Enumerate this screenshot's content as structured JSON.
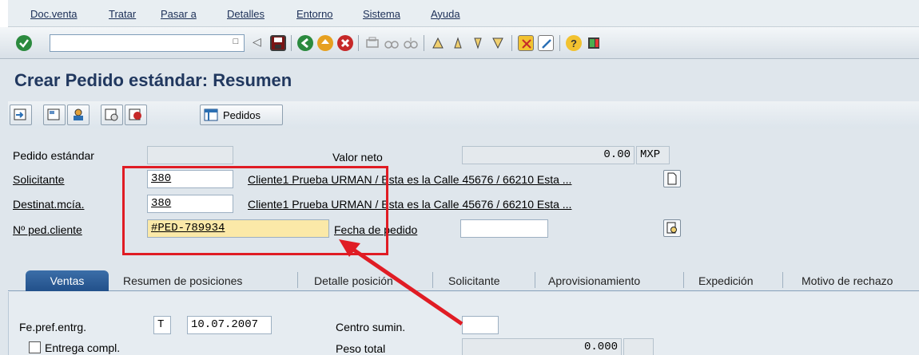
{
  "menubar": {
    "items": [
      "Doc.venta",
      "Tratar",
      "Pasar a",
      "Detalles",
      "Entorno",
      "Sistema",
      "Ayuda"
    ]
  },
  "toolbar": {
    "command_field_value": ""
  },
  "title": "Crear Pedido estándar: Resumen",
  "apptoolbar": {
    "pedidos_label": "Pedidos"
  },
  "header": {
    "pedido_estandar": {
      "label": "Pedido estándar",
      "value": ""
    },
    "valor_neto": {
      "label": "Valor neto",
      "value": "0.00",
      "currency": "MXP"
    },
    "solicitante": {
      "label": "Solicitante",
      "value": "380",
      "desc": "Cliente1 Prueba URMAN / Esta es la Calle 45676 / 66210 Esta ..."
    },
    "destinatario": {
      "label": "Destinat.mcía.",
      "value": "380",
      "desc": "Cliente1 Prueba URMAN / Esta es la Calle 45676 / 66210 Esta ..."
    },
    "ped_cliente": {
      "label": "Nº ped.cliente",
      "value": "#PED-789934"
    },
    "fecha_pedido": {
      "label": "Fecha de pedido",
      "value": ""
    }
  },
  "tabs": [
    {
      "label": "Ventas",
      "active": true
    },
    {
      "label": "Resumen de posiciones",
      "active": false
    },
    {
      "label": "Detalle posición",
      "active": false
    },
    {
      "label": "Solicitante",
      "active": false
    },
    {
      "label": "Aprovisionamiento",
      "active": false
    },
    {
      "label": "Expedición",
      "active": false
    },
    {
      "label": "Motivo de rechazo",
      "active": false
    }
  ],
  "ventas": {
    "fe_pref_entrg": {
      "label": "Fe.pref.entrg.",
      "type": "T",
      "date": "10.07.2007"
    },
    "centro_sumin": {
      "label": "Centro sumin.",
      "value": ""
    },
    "entrega_compl": {
      "label": "Entrega compl.",
      "checked": false
    },
    "peso_total": {
      "label": "Peso total",
      "value": "0.000",
      "unit": ""
    }
  },
  "colors": {
    "title": "#21385f",
    "annotation": "#e01c24",
    "active_tab": "#2d5f9a",
    "highlight_field": "#fbe9a8"
  }
}
